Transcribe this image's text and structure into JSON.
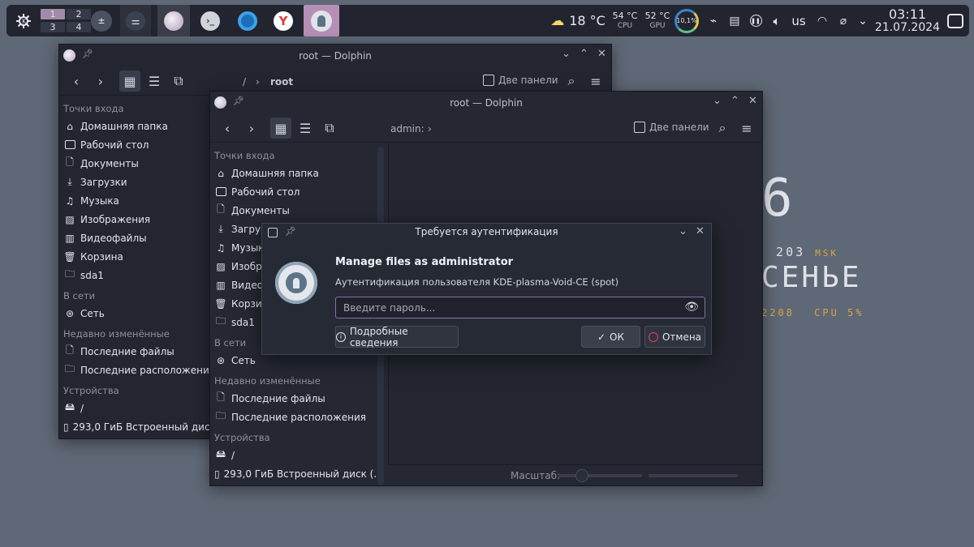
{
  "panel": {
    "pager": [
      "1",
      "2",
      "3",
      "4"
    ],
    "weather": "18 °C",
    "cpu": {
      "value": "54 °C",
      "label": "CPU"
    },
    "gpu": {
      "value": "52 °C",
      "label": "GPU"
    },
    "ring": "10,1%",
    "keyboard": "us",
    "clock": {
      "time": "03:11",
      "date": "21.07.2024"
    }
  },
  "desktop": {
    "big_digit": "6",
    "line1": "ь 203",
    "line1_tz": "MSK",
    "line2": "СЕНЬЕ",
    "line3": "2208",
    "line3_cpu": "CPU 5%"
  },
  "win_back": {
    "title": "root — Dolphin",
    "crumb_root": "/",
    "crumb_current": "root",
    "split_label": "Две панели"
  },
  "win_front": {
    "title": "root — Dolphin",
    "crumb_current": "admin:",
    "split_label": "Две панели",
    "zoom_label": "Масштаб:"
  },
  "places": {
    "section_entry": "Точки входа",
    "items": [
      "Домашняя папка",
      "Рабочий стол",
      "Документы",
      "Загрузки",
      "Музыка",
      "Изображения",
      "Видеофайлы",
      "Корзина",
      "sda1"
    ],
    "section_network": "В сети",
    "network_item": "Сеть",
    "section_recent": "Недавно изменённые",
    "recent_files": "Последние файлы",
    "recent_locations": "Последние расположения",
    "section_devices": "Устройства",
    "device_root": "/",
    "device_disk": "293,0 ГиБ Встроенный диск (..."
  },
  "places_back_partial": {
    "items": [
      "Загру",
      "Музык",
      "Изобр",
      "Видео",
      "Корзи"
    ]
  },
  "auth": {
    "title": "Требуется аутентификация",
    "heading": "Manage files as administrator",
    "subtext": "Аутентификация пользователя KDE-plasma-Void-CE (spot)",
    "password_placeholder": "Введите пароль...",
    "details_label": "Подробные сведения",
    "ok_label": "ОК",
    "cancel_label": "Отмена"
  }
}
